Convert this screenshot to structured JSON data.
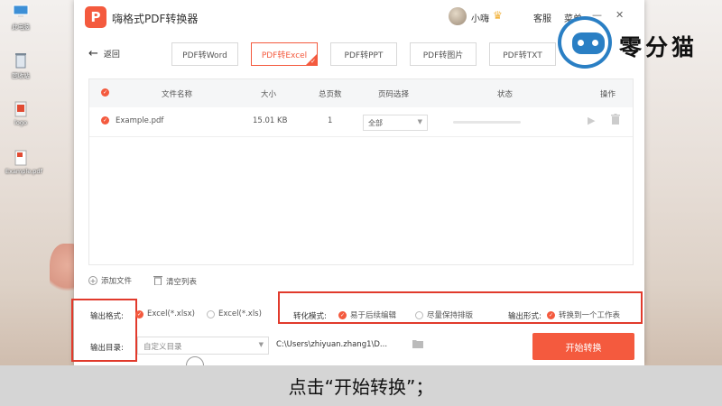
{
  "desktop": {
    "icons": [
      {
        "label": "此电脑",
        "icon": "computer-icon"
      },
      {
        "label": "回收站",
        "icon": "recycle-bin-icon"
      },
      {
        "label": "logo",
        "icon": "image-file-icon"
      },
      {
        "label": "Example.pdf",
        "icon": "pdf-file-icon"
      }
    ]
  },
  "app": {
    "title": "嗨格式PDF转换器",
    "logo_letter": "P",
    "user": "小嗨",
    "service": "客服",
    "menu": "菜单",
    "back": "返回",
    "tabs": [
      {
        "label": "PDF转Word",
        "active": false
      },
      {
        "label": "PDF转Excel",
        "active": true
      },
      {
        "label": "PDF转PPT",
        "active": false
      },
      {
        "label": "PDF转图片",
        "active": false
      },
      {
        "label": "PDF转TXT",
        "active": false
      }
    ],
    "table": {
      "headers": {
        "name": "文件名称",
        "size": "大小",
        "pages": "总页数",
        "range": "页码选择",
        "status": "状态",
        "action": "操作"
      },
      "rows": [
        {
          "name": "Example.pdf",
          "size": "15.01 KB",
          "pages": "1",
          "range": "全部",
          "progress": 0
        }
      ]
    },
    "add_file": "添加文件",
    "clear_list": "清空列表",
    "output_format": {
      "label": "输出格式:",
      "options": [
        {
          "label": "Excel(*.xlsx)",
          "selected": true
        },
        {
          "label": "Excel(*.xls)",
          "selected": false
        }
      ]
    },
    "convert_mode": {
      "label": "转化模式:",
      "options": [
        {
          "label": "易于后续编辑",
          "selected": true
        },
        {
          "label": "尽量保持排版",
          "selected": false
        }
      ]
    },
    "output_form": {
      "label": "输出形式:",
      "option": "转换到一个工作表"
    },
    "output_dir": {
      "label": "输出目录:",
      "select_value": "自定义目录",
      "path": "C:\\Users\\zhiyuan.zhang1\\D..."
    },
    "start_button": "开始转换"
  },
  "watermark": {
    "text": "零分猫"
  },
  "caption": "点击“开始转换”；",
  "colors": {
    "accent": "#f45a3e",
    "highlight_box": "#e13a2c",
    "watermark_blue": "#2a7fc4"
  }
}
